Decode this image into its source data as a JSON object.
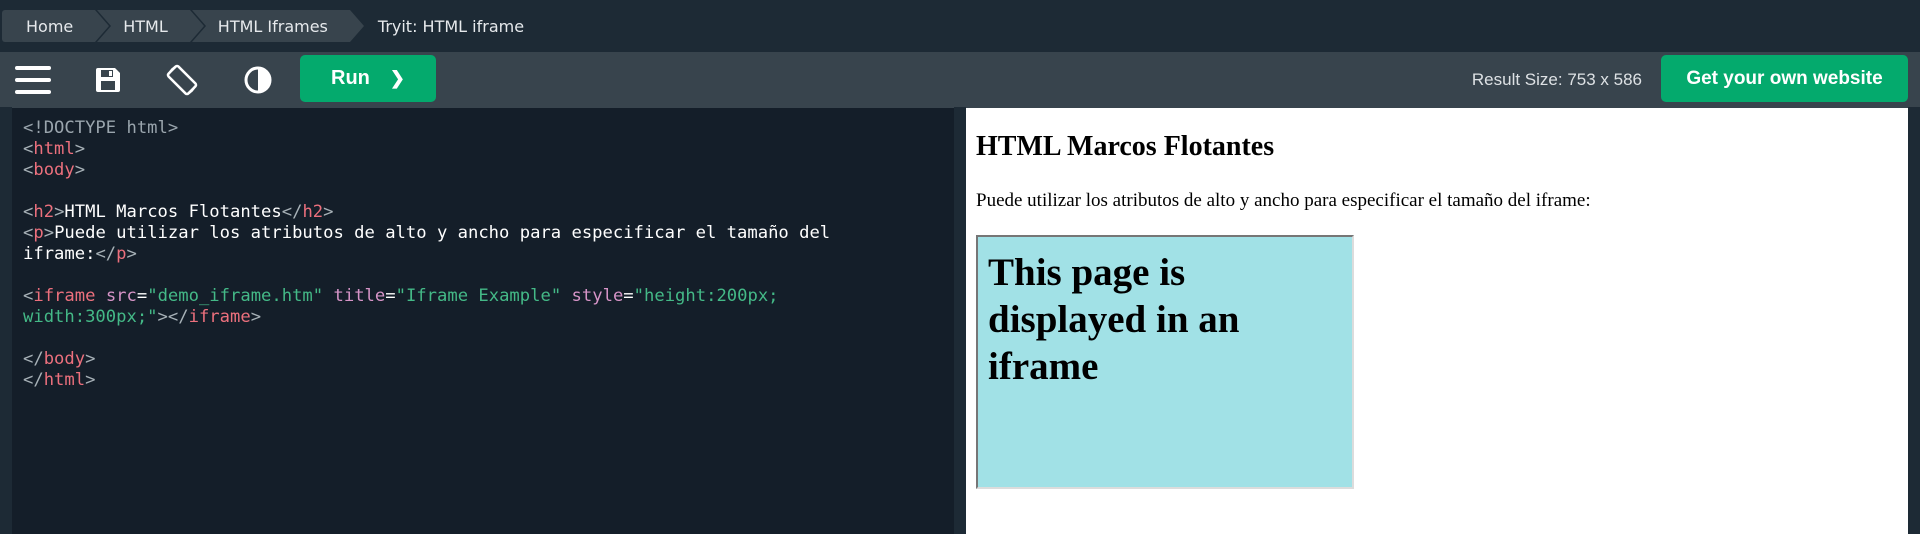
{
  "breadcrumb": {
    "items": [
      "Home",
      "HTML",
      "HTML Iframes"
    ],
    "current": "Tryit: HTML iframe"
  },
  "toolbar": {
    "icons": [
      "menu-icon",
      "save-icon",
      "rotate-screen-icon",
      "contrast-icon"
    ],
    "run_label": "Run",
    "run_chevron": "❯",
    "result_size": "Result Size: 753 x 586",
    "own_website_label": "Get your own website"
  },
  "editor": {
    "lines": [
      [
        {
          "t": "<!DOCTYPE html>",
          "c": "doctype"
        }
      ],
      [
        {
          "t": "<",
          "c": "br"
        },
        {
          "t": "html",
          "c": "tag"
        },
        {
          "t": ">",
          "c": "br"
        }
      ],
      [
        {
          "t": "<",
          "c": "br"
        },
        {
          "t": "body",
          "c": "tag"
        },
        {
          "t": ">",
          "c": "br"
        }
      ],
      [],
      [
        {
          "t": "<",
          "c": "br"
        },
        {
          "t": "h2",
          "c": "tag"
        },
        {
          "t": ">",
          "c": "br"
        },
        {
          "t": "HTML Marcos Flotantes",
          "c": "txt"
        },
        {
          "t": "</",
          "c": "br"
        },
        {
          "t": "h2",
          "c": "tag"
        },
        {
          "t": ">",
          "c": "br"
        }
      ],
      [
        {
          "t": "<",
          "c": "br"
        },
        {
          "t": "p",
          "c": "tag"
        },
        {
          "t": ">",
          "c": "br"
        },
        {
          "t": "Puede utilizar los atributos de alto y ancho para especificar el tamaño del",
          "c": "txt"
        }
      ],
      [
        {
          "t": "iframe:",
          "c": "txt"
        },
        {
          "t": "</",
          "c": "br"
        },
        {
          "t": "p",
          "c": "tag"
        },
        {
          "t": ">",
          "c": "br"
        }
      ],
      [],
      [
        {
          "t": "<",
          "c": "br"
        },
        {
          "t": "iframe",
          "c": "tag"
        },
        {
          "t": " ",
          "c": "txt"
        },
        {
          "t": "src",
          "c": "attr"
        },
        {
          "t": "=",
          "c": "txt"
        },
        {
          "t": "\"demo_iframe.htm\"",
          "c": "val"
        },
        {
          "t": " ",
          "c": "txt"
        },
        {
          "t": "title",
          "c": "attr"
        },
        {
          "t": "=",
          "c": "txt"
        },
        {
          "t": "\"Iframe Example\"",
          "c": "val"
        },
        {
          "t": " ",
          "c": "txt"
        },
        {
          "t": "style",
          "c": "attr"
        },
        {
          "t": "=",
          "c": "txt"
        },
        {
          "t": "\"height:200px;",
          "c": "val"
        }
      ],
      [
        {
          "t": "width:300px;\"",
          "c": "val"
        },
        {
          "t": ">",
          "c": "br"
        },
        {
          "t": "</",
          "c": "br"
        },
        {
          "t": "iframe",
          "c": "tag"
        },
        {
          "t": ">",
          "c": "br"
        }
      ],
      [],
      [
        {
          "t": "</",
          "c": "br"
        },
        {
          "t": "body",
          "c": "tag"
        },
        {
          "t": ">",
          "c": "br"
        }
      ],
      [
        {
          "t": "</",
          "c": "br"
        },
        {
          "t": "html",
          "c": "tag"
        },
        {
          "t": ">",
          "c": "br"
        }
      ]
    ]
  },
  "result": {
    "heading": "HTML Marcos Flotantes",
    "paragraph": "Puede utilizar los atributos de alto y ancho para especificar el tamaño del iframe:",
    "iframe_text": "This page is displayed in an iframe"
  },
  "colors": {
    "accent_green": "#04aa6d",
    "toolbar_bg": "#38444d",
    "page_bg": "#1d2a35",
    "editor_bg": "#141e29",
    "iframe_bg": "#a1e1e6"
  }
}
